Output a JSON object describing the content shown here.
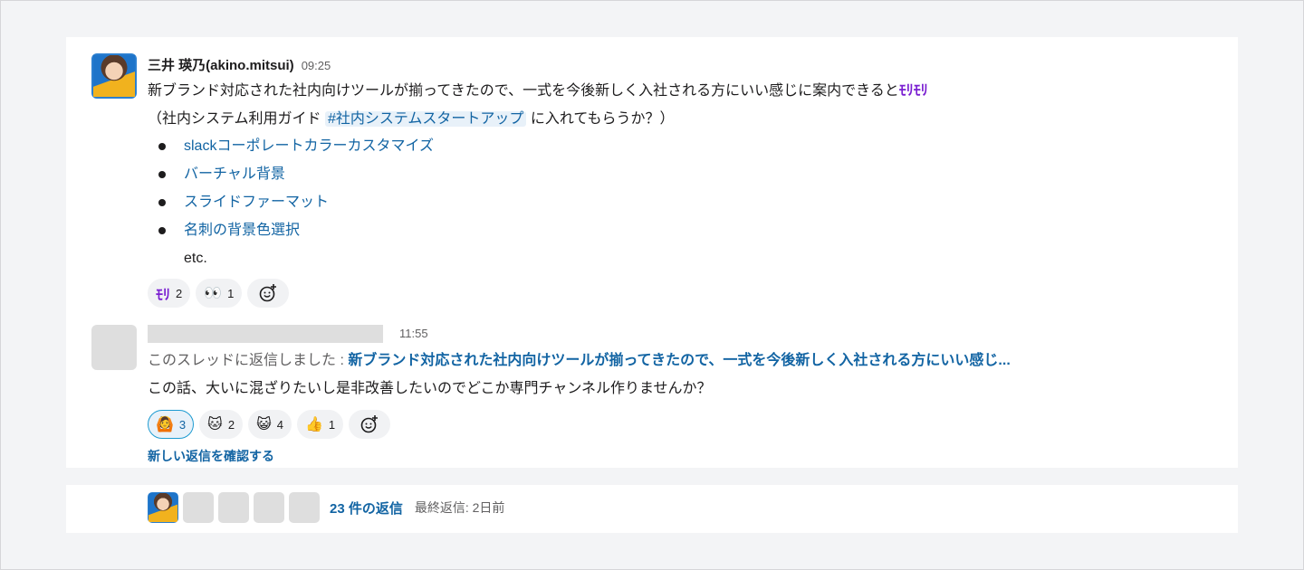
{
  "message1": {
    "author": "三井 瑛乃(akino.mitsui)",
    "time": "09:25",
    "text_main": "新ブランド対応された社内向けツールが揃ってきたので、一式を今後新しく入社される方にいい感じに案内できると",
    "custom_emoji": "ﾓﾘﾓﾘ",
    "text_paren_start": "（社内システム利用ガイド ",
    "channel": "#社内システムスタートアップ",
    "text_paren_end": " に入れてもらうか？）",
    "list": [
      "slackコーポレートカラーカスタマイズ",
      "バーチャル背景",
      "スライドファーマット",
      "名刺の背景色選択"
    ],
    "etc": "etc.",
    "reactions": [
      {
        "icon": "custom-purple-emoji",
        "glyph": "ﾓﾘ",
        "count": "2"
      },
      {
        "icon": "eyes-emoji",
        "glyph": "👀",
        "count": "1"
      }
    ]
  },
  "message2": {
    "time": "11:55",
    "reply_prefix": "このスレッドに返信しました : ",
    "reply_link": "新ブランド対応された社内向けツールが揃ってきたので、一式を今後新しく入社される方にいい感じ...",
    "text": "この話、大いに混ざりたいし是非改善したいのでどこか専門チャンネル作りませんか？",
    "reactions": [
      {
        "icon": "person-emoji",
        "glyph": "🙆",
        "count": "3",
        "active": true
      },
      {
        "icon": "cat-emoji",
        "glyph": "🐱",
        "count": "2"
      },
      {
        "icon": "cat-face-emoji",
        "glyph": "😺",
        "count": "4"
      },
      {
        "icon": "thumbs-up-emoji",
        "glyph": "👍",
        "count": "1"
      }
    ],
    "new_replies": "新しい返信を確認する"
  },
  "thread": {
    "count_label": "23 件の返信",
    "last_reply": "最終返信: 2日前"
  },
  "colors": {
    "link": "#1264a3",
    "custom_emoji": "#7a1fd1",
    "placeholder": "#dedede"
  }
}
